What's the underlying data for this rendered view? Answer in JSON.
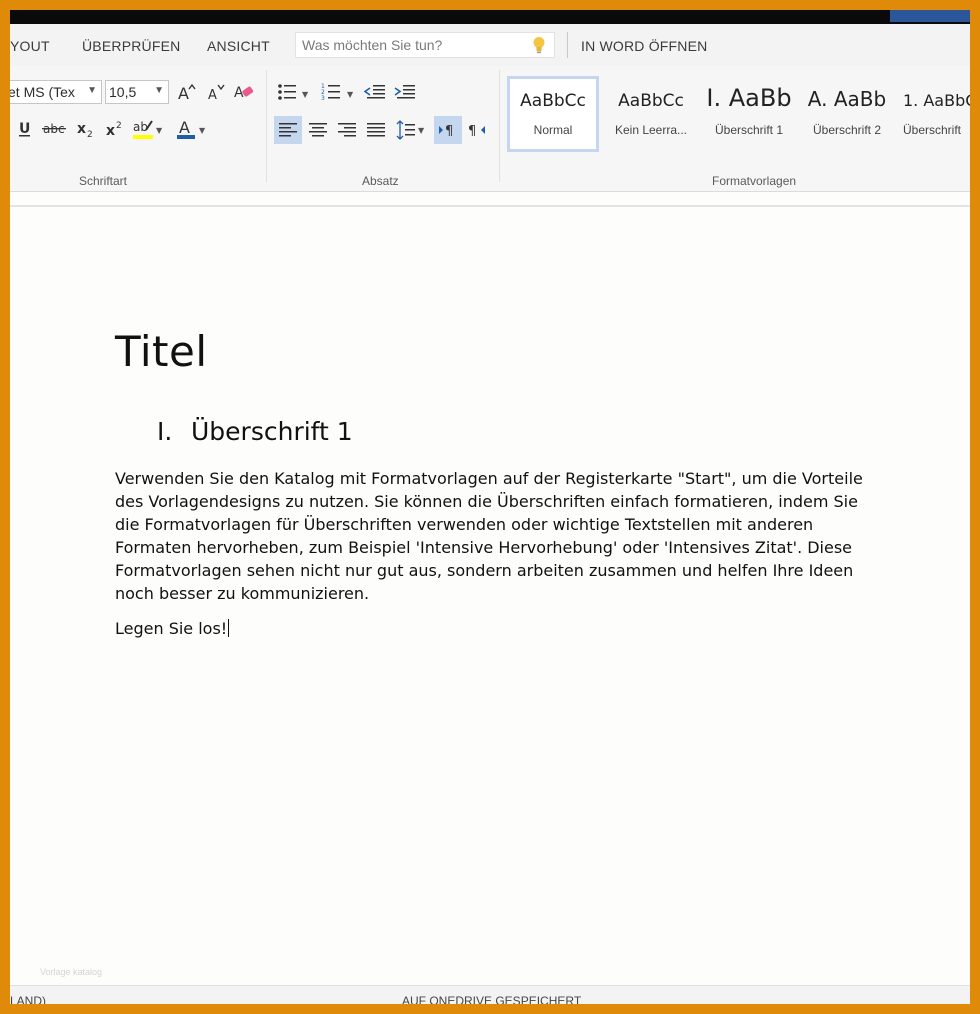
{
  "tabs": [
    "YOUT",
    "ÜBERPRÜFEN",
    "ANSICHT"
  ],
  "search": {
    "placeholder": "Was möchten Sie tun?"
  },
  "open_in_word": "IN WORD ÖFFNEN",
  "font": {
    "name": "et MS (Tex",
    "size": "10,5",
    "group_label": "Schriftart"
  },
  "paragraph": {
    "group_label": "Absatz"
  },
  "styles": {
    "group_label": "Formatvorlagen",
    "items": [
      {
        "sample": "AaBbCc",
        "name": "Normal"
      },
      {
        "sample": "AaBbCc",
        "name": "Kein Leerra..."
      },
      {
        "sample": "I. AaBb",
        "name": "Überschrift 1"
      },
      {
        "sample": "A. AaBb",
        "name": "Überschrift 2"
      },
      {
        "sample": "1. AaBbC",
        "name": "Überschrift"
      }
    ]
  },
  "document": {
    "title": "Titel",
    "heading1": {
      "number": "I.",
      "text": "Überschrift 1"
    },
    "body": "Verwenden Sie den Katalog mit Formatvorlagen auf der Registerkarte \"Start\", um die Vorteile des Vorlagendesigns zu nutzen. Sie können die Überschriften einfach formatieren, indem Sie die Formatvorlagen für Überschriften verwenden oder wichtige Textstellen mit anderen Formaten hervorheben, zum Beispiel 'Intensive Hervorhebung' oder 'Intensives Zitat'. Diese Formatvorlagen sehen nicht nur gut aus, sondern arbeiten zusammen und helfen Ihre Ideen noch besser zu kommunizieren.",
    "closing": "Legen Sie los!"
  },
  "watermark": "Vorlage katalog",
  "status": {
    "left": "LAND)",
    "center": "AUF ONEDRIVE GESPEICHERT"
  },
  "colors": {
    "frame": "#e08a0a",
    "highlight": "#ffff00",
    "font_color": "#1f5fa8",
    "accent": "#2b579a",
    "selected": "#c5d7ef"
  },
  "icons": [
    "lightbulb-icon",
    "grow-font-icon",
    "shrink-font-icon",
    "clear-formatting-icon",
    "underline-icon",
    "strikethrough-icon",
    "subscript-icon",
    "superscript-icon",
    "highlight-icon",
    "font-color-icon",
    "bullets-icon",
    "numbering-icon",
    "decrease-indent-icon",
    "increase-indent-icon",
    "align-left-icon",
    "align-center-icon",
    "align-right-icon",
    "justify-icon",
    "line-spacing-icon",
    "ltr-icon",
    "rtl-icon"
  ]
}
